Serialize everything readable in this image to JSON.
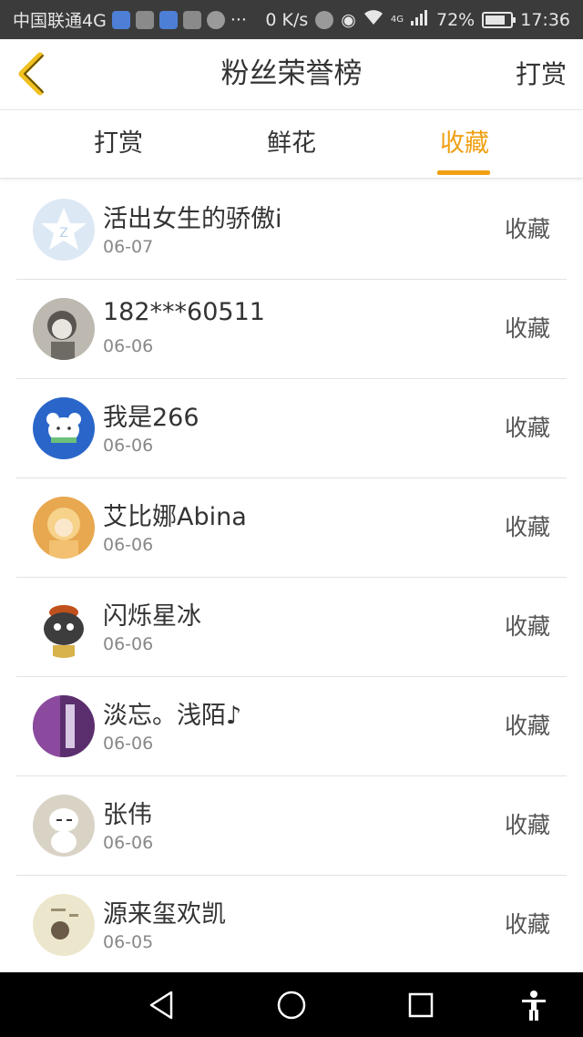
{
  "status_bar": {
    "carrier": "中国联通4G",
    "more": "···",
    "net_speed": "0 K/s",
    "network": "4G",
    "battery": "72%",
    "time": "17:36"
  },
  "header": {
    "title": "粉丝荣誉榜",
    "action": "打赏"
  },
  "tabs": [
    {
      "label": "打赏",
      "active": false
    },
    {
      "label": "鲜花",
      "active": false
    },
    {
      "label": "收藏",
      "active": true
    }
  ],
  "accent_color": "#f0a013",
  "list": [
    {
      "name": "活出女生的骄傲i",
      "date": "06-07",
      "action": "收藏",
      "avatar_icon": "star-avatar-icon"
    },
    {
      "name": "182***60511",
      "date": "06-06",
      "action": "收藏",
      "avatar_icon": "portrait-avatar-icon"
    },
    {
      "name": "我是266",
      "date": "06-06",
      "action": "收藏",
      "avatar_icon": "bear-avatar-icon"
    },
    {
      "name": "艾比娜Abina",
      "date": "06-06",
      "action": "收藏",
      "avatar_icon": "girl-avatar-icon"
    },
    {
      "name": "闪烁星冰",
      "date": "06-06",
      "action": "收藏",
      "avatar_icon": "cartoon-avatar-icon"
    },
    {
      "name": "淡忘。浅陌♪",
      "date": "06-06",
      "action": "收藏",
      "avatar_icon": "purple-avatar-icon"
    },
    {
      "name": "张伟",
      "date": "06-06",
      "action": "收藏",
      "avatar_icon": "snowman-avatar-icon"
    },
    {
      "name": "源来玺欢凯",
      "date": "06-05",
      "action": "收藏",
      "avatar_icon": "sketch-avatar-icon"
    }
  ],
  "navbar": [
    "back-triangle-icon",
    "home-circle-icon",
    "recents-square-icon",
    "accessibility-icon"
  ]
}
